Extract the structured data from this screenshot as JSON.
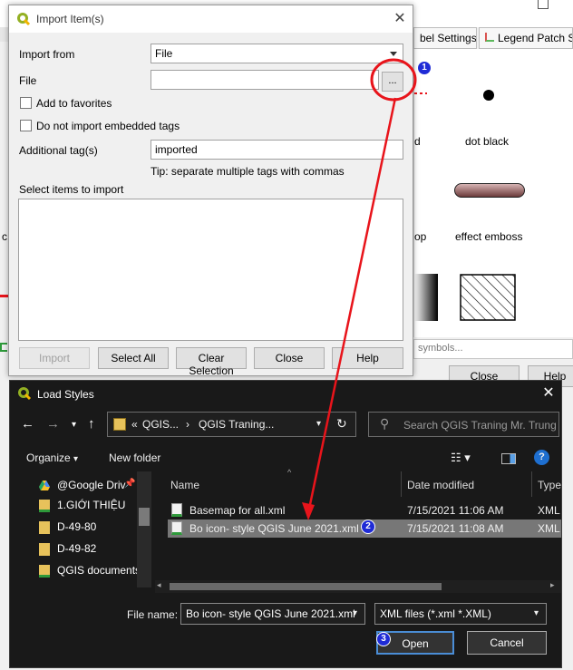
{
  "background_window": {
    "tabs": [
      {
        "label": "bel Settings"
      },
      {
        "label": "Legend Patch Sh"
      }
    ],
    "symbols": [
      {
        "label": "dot  black"
      },
      {
        "label": "effect emboss"
      },
      {
        "label": "d"
      },
      {
        "label": "op"
      }
    ],
    "left_edge_label": "c",
    "search_placeholder": "symbols...",
    "buttons": {
      "close": "Close",
      "help": "Help"
    }
  },
  "import_dialog": {
    "title": "Import Item(s)",
    "import_from_label": "Import from",
    "import_from_value": "File",
    "file_label": "File",
    "file_value": "",
    "browse_label": "...",
    "add_to_favorites": "Add to favorites",
    "no_embedded_tags": "Do not import embedded tags",
    "additional_tags_label": "Additional tag(s)",
    "additional_tags_value": "imported",
    "tip": "Tip: separate multiple tags with commas",
    "select_items_label": "Select items to import",
    "buttons": {
      "import": "Import",
      "select_all": "Select All",
      "clear_selection": "Clear Selection",
      "close": "Close",
      "help": "Help"
    }
  },
  "load_styles": {
    "title": "Load Styles",
    "breadcrumb": {
      "prefix": "«",
      "part1": "QGIS...",
      "sep": "›",
      "part2": "QGIS Traning..."
    },
    "search_placeholder": "Search QGIS Traning Mr. Trung",
    "organize": "Organize",
    "new_folder": "New folder",
    "sidebar_items": [
      {
        "label": "@Google Driv"
      },
      {
        "label": "1.GIỚI THIỆU"
      },
      {
        "label": "D-49-80"
      },
      {
        "label": "D-49-82"
      },
      {
        "label": "QGIS documents"
      }
    ],
    "columns": {
      "name": "Name",
      "date": "Date modified",
      "type": "Type"
    },
    "files": [
      {
        "name": "Basemap for all.xml",
        "date": "7/15/2021 11:06 AM",
        "type": "XML"
      },
      {
        "name": "Bo icon- style QGIS June 2021.xml",
        "date": "7/15/2021 11:08 AM",
        "type": "XML"
      }
    ],
    "file_name_label": "File name:",
    "file_name_value": "Bo icon- style QGIS June 2021.xml",
    "file_type_value": "XML files (*.xml *.XML)",
    "buttons": {
      "open": "Open",
      "cancel": "Cancel"
    }
  },
  "annotations": {
    "badge1": "1",
    "badge2": "2",
    "badge3": "3",
    "arrow_color": "#e8141b",
    "badge_color": "#1f2bd6"
  }
}
